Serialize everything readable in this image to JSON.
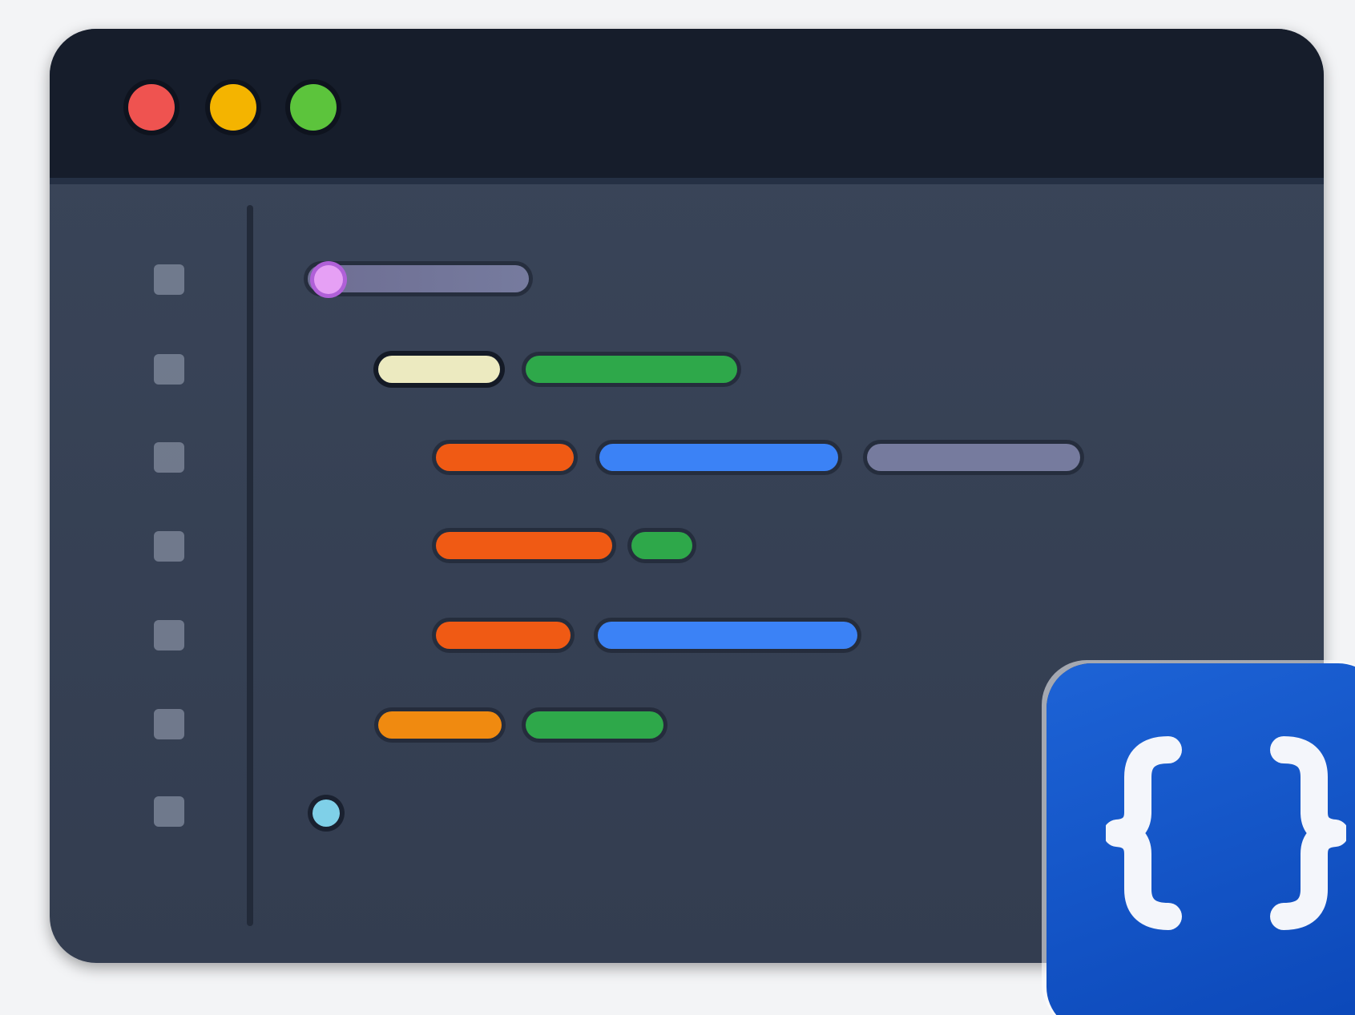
{
  "window": {
    "title": "",
    "traffic_lights": [
      {
        "name": "close",
        "color": "#ef5350"
      },
      {
        "name": "minimize",
        "color": "#f4b400"
      },
      {
        "name": "zoom",
        "color": "#5cc43c"
      }
    ]
  },
  "editor": {
    "line_count": 7,
    "token_colors": {
      "tag": "#d08af0",
      "comment": "#767b9e",
      "string": "#eceac0",
      "green": "#2ea84a",
      "keyword": "#f05a14",
      "function": "#3b82f6",
      "number": "#f08a10",
      "cyan": "#7fd0e8"
    }
  },
  "badge": {
    "icon": "curly-braces-icon",
    "color": "#0b47b8"
  }
}
